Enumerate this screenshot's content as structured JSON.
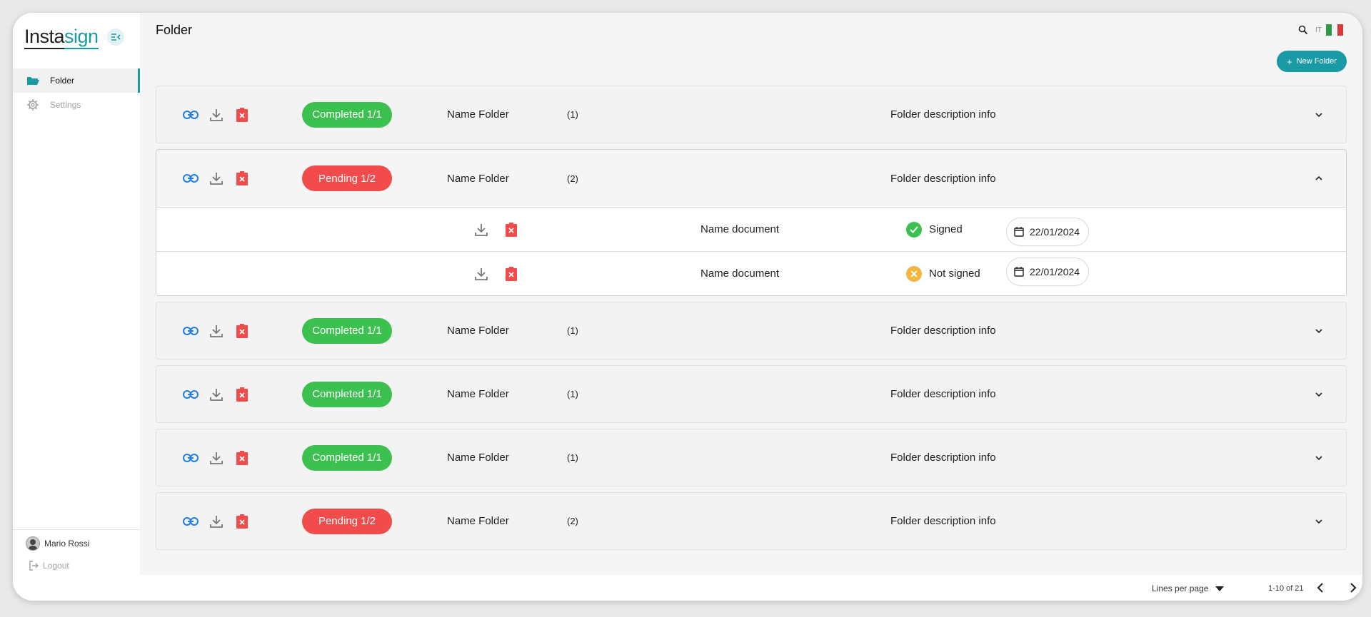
{
  "app": {
    "logo_part1": "Insta",
    "logo_part2": "sign",
    "brand_color": "#1a9aa4"
  },
  "sidebar": {
    "items": [
      {
        "label": "Folder",
        "icon": "folder-icon",
        "active": true
      },
      {
        "label": "Settings",
        "icon": "gear-icon",
        "active": false
      }
    ],
    "user_name": "Mario Rossi",
    "logout_label": "Logout"
  },
  "header": {
    "title": "Folder",
    "lang": "IT",
    "new_folder_label": "New Folder"
  },
  "folders": [
    {
      "status": "Completed 1/1",
      "status_type": "completed",
      "name": "Name Folder",
      "count": "(1)",
      "description": "Folder description info",
      "expanded": false
    },
    {
      "status": "Pending 1/2",
      "status_type": "pending",
      "name": "Name Folder",
      "count": "(2)",
      "description": "Folder description info",
      "expanded": true,
      "documents": [
        {
          "name": "Name document",
          "status": "Signed",
          "status_type": "signed",
          "date": "22/01/2024"
        },
        {
          "name": "Name document",
          "status": "Not signed",
          "status_type": "not-signed",
          "date": "22/01/2024"
        }
      ]
    },
    {
      "status": "Completed 1/1",
      "status_type": "completed",
      "name": "Name Folder",
      "count": "(1)",
      "description": "Folder description info",
      "expanded": false
    },
    {
      "status": "Completed 1/1",
      "status_type": "completed",
      "name": "Name Folder",
      "count": "(1)",
      "description": "Folder description info",
      "expanded": false
    },
    {
      "status": "Completed 1/1",
      "status_type": "completed",
      "name": "Name Folder",
      "count": "(1)",
      "description": "Folder description info",
      "expanded": false
    },
    {
      "status": "Pending 1/2",
      "status_type": "pending",
      "name": "Name Folder",
      "count": "(2)",
      "description": "Folder description info",
      "expanded": false
    }
  ],
  "pagination": {
    "lines_per_page_label": "Lines per page",
    "range_label": "1-10 of 21"
  },
  "colors": {
    "completed": "#3cc04f",
    "pending": "#f24b4b",
    "signed": "#3cc04f",
    "not_signed": "#f5b73b"
  }
}
